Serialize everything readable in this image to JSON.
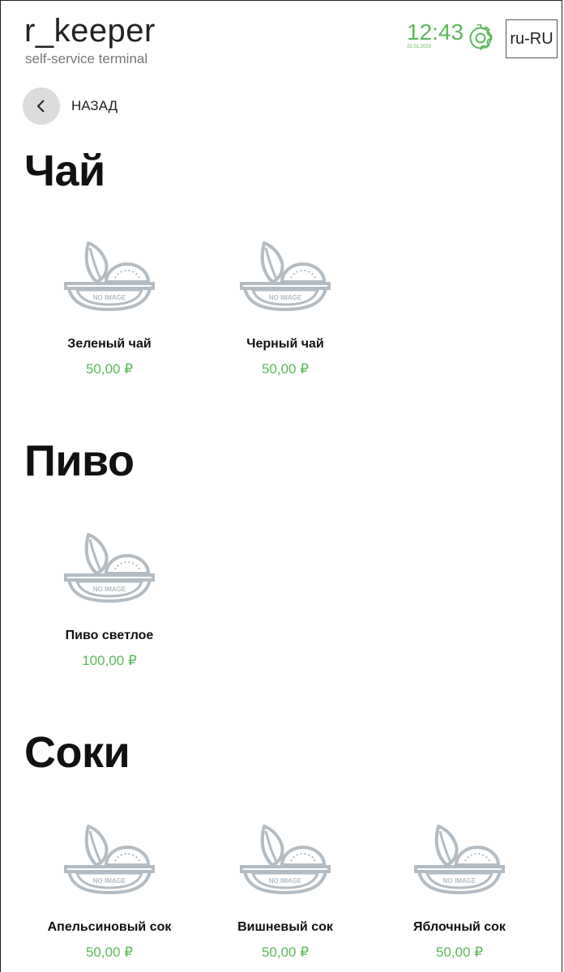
{
  "header": {
    "logo_title": "r_keeper",
    "logo_subtitle": "self-service terminal",
    "time": "12:43",
    "date": "22.01.2020",
    "language": "ru-RU",
    "accent_color": "#5cb85c"
  },
  "nav": {
    "back_label": "НАЗАД"
  },
  "placeholder_text": "NO IMAGE",
  "sections": [
    {
      "title": "Чай",
      "items": [
        {
          "name": "Зеленый чай",
          "price": "50,00 ₽"
        },
        {
          "name": "Черный чай",
          "price": "50,00 ₽"
        }
      ]
    },
    {
      "title": "Пиво",
      "items": [
        {
          "name": "Пиво светлое",
          "price": "100,00 ₽"
        }
      ]
    },
    {
      "title": "Соки",
      "items": [
        {
          "name": "Апельсиновый сок",
          "price": "50,00 ₽"
        },
        {
          "name": "Вишневый сок",
          "price": "50,00 ₽"
        },
        {
          "name": "Яблочный сок",
          "price": "50,00 ₽"
        }
      ]
    }
  ]
}
